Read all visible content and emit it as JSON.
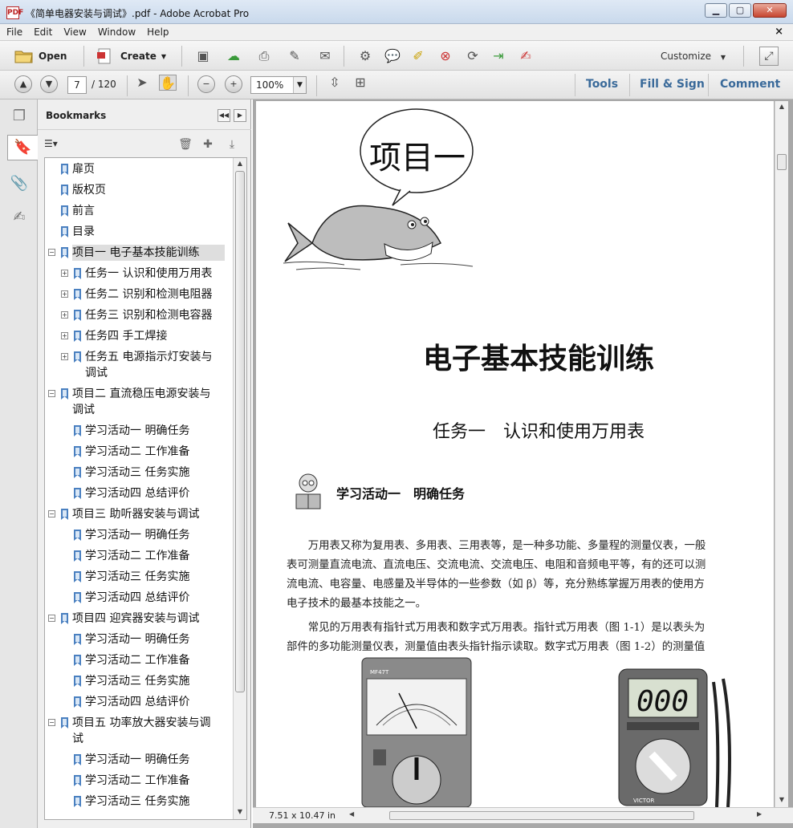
{
  "window": {
    "title": "《简单电器安装与调试》.pdf - Adobe Acrobat Pro",
    "app_icon_text": "PDF",
    "min": "▁",
    "max": "▢",
    "close": "✕"
  },
  "menu": [
    "File",
    "Edit",
    "View",
    "Window",
    "Help"
  ],
  "menu_close": "×",
  "toolbar": {
    "open": "Open",
    "create": "Create",
    "customize": "Customize"
  },
  "nav": {
    "page": "7",
    "total": "/ 120",
    "zoom": "100%",
    "tools": "Tools",
    "fill_sign": "Fill & Sign",
    "comment": "Comment"
  },
  "bookmarks": {
    "title": "Bookmarks",
    "items": [
      {
        "label": "扉页",
        "level": 0,
        "expand": "",
        "selected": false
      },
      {
        "label": "版权页",
        "level": 0,
        "expand": "",
        "selected": false
      },
      {
        "label": "前言",
        "level": 0,
        "expand": "",
        "selected": false
      },
      {
        "label": "目录",
        "level": 0,
        "expand": "",
        "selected": false
      },
      {
        "label": "项目一  电子基本技能训练",
        "level": 0,
        "expand": "−",
        "selected": true
      },
      {
        "label": "任务一  认识和使用万用表",
        "level": 1,
        "expand": "+",
        "selected": false
      },
      {
        "label": "任务二  识别和检测电阻器",
        "level": 1,
        "expand": "+",
        "selected": false
      },
      {
        "label": "任务三  识别和检测电容器",
        "level": 1,
        "expand": "+",
        "selected": false
      },
      {
        "label": "任务四  手工焊接",
        "level": 1,
        "expand": "+",
        "selected": false
      },
      {
        "label": "任务五  电源指示灯安装与",
        "label2": "调试",
        "level": 1,
        "expand": "+",
        "selected": false
      },
      {
        "label": "项目二  直流稳压电源安装与",
        "label2": "调试",
        "level": 0,
        "expand": "−",
        "selected": false
      },
      {
        "label": "学习活动一  明确任务",
        "level": 1,
        "expand": "",
        "selected": false
      },
      {
        "label": "学习活动二  工作准备",
        "level": 1,
        "expand": "",
        "selected": false
      },
      {
        "label": "学习活动三  任务实施",
        "level": 1,
        "expand": "",
        "selected": false
      },
      {
        "label": "学习活动四  总结评价",
        "level": 1,
        "expand": "",
        "selected": false
      },
      {
        "label": "项目三  助听器安装与调试",
        "level": 0,
        "expand": "−",
        "selected": false
      },
      {
        "label": "学习活动一  明确任务",
        "level": 1,
        "expand": "",
        "selected": false
      },
      {
        "label": "学习活动二  工作准备",
        "level": 1,
        "expand": "",
        "selected": false
      },
      {
        "label": "学习活动三  任务实施",
        "level": 1,
        "expand": "",
        "selected": false
      },
      {
        "label": "学习活动四  总结评价",
        "level": 1,
        "expand": "",
        "selected": false
      },
      {
        "label": "项目四  迎宾器安装与调试",
        "level": 0,
        "expand": "−",
        "selected": false
      },
      {
        "label": "学习活动一  明确任务",
        "level": 1,
        "expand": "",
        "selected": false
      },
      {
        "label": "学习活动二  工作准备",
        "level": 1,
        "expand": "",
        "selected": false
      },
      {
        "label": "学习活动三  任务实施",
        "level": 1,
        "expand": "",
        "selected": false
      },
      {
        "label": "学习活动四  总结评价",
        "level": 1,
        "expand": "",
        "selected": false
      },
      {
        "label": "项目五  功率放大器安装与调",
        "label2": "试",
        "level": 0,
        "expand": "−",
        "selected": false
      },
      {
        "label": "学习活动一  明确任务",
        "level": 1,
        "expand": "",
        "selected": false
      },
      {
        "label": "学习活动二  工作准备",
        "level": 1,
        "expand": "",
        "selected": false
      },
      {
        "label": "学习活动三  任务实施",
        "level": 1,
        "expand": "",
        "selected": false
      }
    ]
  },
  "document": {
    "project_bubble": "项目一",
    "main_title": "电子基本技能训练",
    "task_title": "任务一　认识和使用万用表",
    "activity_title": "学习活动一　明确任务",
    "paragraphs": [
      "　　万用表又称为复用表、多用表、三用表等，是一种多功能、多量程的测量仪表，一般",
      "表可测量直流电流、直流电压、交流电流、交流电压、电阻和音频电平等，有的还可以测",
      "流电流、电容量、电感量及半导体的一些参数（如 β）等，充分熟练掌握万用表的使用方",
      "电子技术的最基本技能之一。",
      "　　常见的万用表有指针式万用表和数字式万用表。指针式万用表（图 1-1）是以表头为",
      "部件的多功能测量仪表，测量值由表头指针指示读取。数字式万用表（图 1-2）的测量值"
    ],
    "analog_meter_brand": "MF47T",
    "digital_display": "000",
    "digital_brand": "VICTOR",
    "page_size": "7.51 x 10.47 in"
  }
}
